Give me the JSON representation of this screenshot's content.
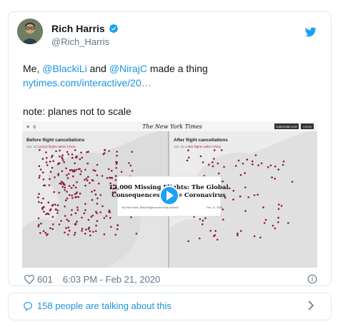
{
  "author": {
    "name": "Rich Harris",
    "handle": "@Rich_Harris"
  },
  "tweet": {
    "line1_prefix": "Me, ",
    "mention1": "@BlackiLi",
    "line1_mid": " and ",
    "mention2": "@NirajC",
    "line1_suffix": " made a thing",
    "link": "nytimes.com/interactive/20…",
    "note": "note: planes not to scale"
  },
  "media": {
    "masthead": "The New York Times",
    "subscribe_label": "SUBSCRIBE NOW",
    "login_label": "LOG IN",
    "left_title": "Before flight cancellations",
    "left_sub_date": "Jan. 23",
    "left_sub_count": "12,814 flights within China",
    "right_title": "After flight cancellations",
    "right_sub_date": "Jan. 23",
    "right_sub_count": "1,882 flights within China",
    "headline_line1": "13,000 Missing Flights: The Global",
    "headline_line2": "Consequences of the Coronavirus",
    "byline": "By Rich Harris, Blacki Migliozzi and Niraj Chokshi",
    "byline_date": "Feb. 21, 2020"
  },
  "meta": {
    "likes": "601",
    "timestamp": "6:03 PM - Feb 21, 2020"
  },
  "footer": {
    "talking": "158 people are talking about this"
  },
  "colors": {
    "link": "#1b95e0",
    "secondary": "#657786",
    "dots": "#8e1a4a",
    "play": "#1da1f2"
  }
}
